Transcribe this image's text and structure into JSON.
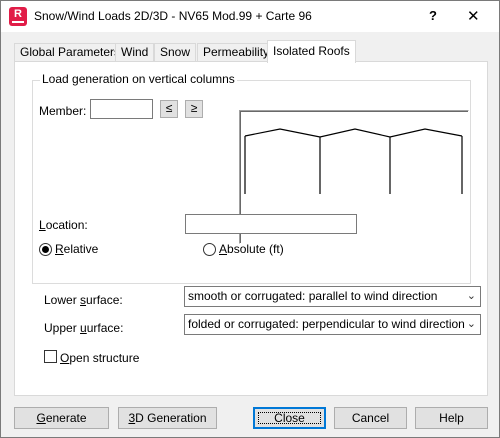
{
  "window": {
    "title": "Snow/Wind Loads 2D/3D - NV65 Mod.99 + Carte 96",
    "app_icon_letter": "R",
    "help_glyph": "?",
    "close_glyph": "✕"
  },
  "tabs": [
    {
      "label": "Global Parameters",
      "active": false
    },
    {
      "label": "Wind",
      "active": false
    },
    {
      "label": "Snow",
      "active": false
    },
    {
      "label": "Permeability",
      "active": false
    },
    {
      "label": "Isolated Roofs",
      "active": true
    }
  ],
  "load_generation": {
    "title": "Load generation on vertical columns",
    "member_label": "Member:",
    "member_value": "",
    "prev_glyph": "≤",
    "next_glyph": "≥",
    "location_label": "Location:",
    "location_value": "",
    "relative_label": "Relative",
    "absolute_label": "Absolute (ft)",
    "selected_mode": "relative"
  },
  "surfaces": {
    "lower_label": "Lower surface:",
    "lower_value": "smooth or corrugated: parallel to wind direction",
    "upper_label": "Upper surface:",
    "upper_value": "folded or corrugated: perpendicular to wind direction",
    "open_structure_label": "Open structure",
    "open_structure_checked": false
  },
  "buttons": {
    "generate": "Generate",
    "generation_3d": "3D Generation",
    "close": "Close",
    "cancel": "Cancel",
    "help": "Help"
  },
  "icons": {
    "app": "robot-app-icon",
    "dropdown": "chevron-down-icon"
  }
}
